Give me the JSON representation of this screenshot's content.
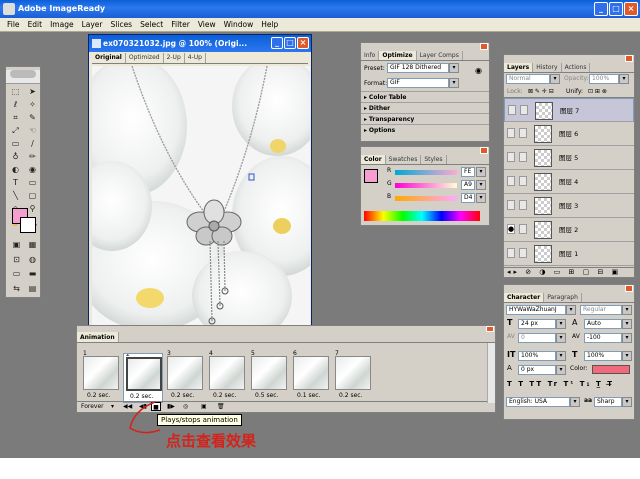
{
  "window": {
    "title": "Adobe ImageReady"
  },
  "menu": [
    "File",
    "Edit",
    "Image",
    "Layer",
    "Slices",
    "Select",
    "Filter",
    "View",
    "Window",
    "Help"
  ],
  "image_window": {
    "title": "ex070321032.jpg @ 100% (Origi...",
    "tabs": [
      "Original",
      "Optimized",
      "2-Up",
      "4-Up"
    ]
  },
  "optimize_panel": {
    "tabs": [
      "Info",
      "Optimize",
      "Layer Comps"
    ],
    "preset_label": "Preset:",
    "preset_value": "GIF 128 Dithered",
    "format_label": "Format:",
    "format_value": "GIF",
    "sections": [
      "Color Table",
      "Dither",
      "Transparency",
      "Options"
    ]
  },
  "color_panel": {
    "tabs": [
      "Color",
      "Swatches",
      "Styles"
    ],
    "channels": [
      {
        "label": "R",
        "value": "FE"
      },
      {
        "label": "G",
        "value": "A9"
      },
      {
        "label": "B",
        "value": "D4"
      }
    ],
    "foreground": "#f49fd0"
  },
  "layers_panel": {
    "tabs": [
      "Layers",
      "History",
      "Actions"
    ],
    "blend_mode": "Normal",
    "opacity_label": "Opacity:",
    "opacity_value": "100%",
    "lock_label": "Lock:",
    "unify_label": "Unify:",
    "layers": [
      "图层 7",
      "图层 6",
      "图层 5",
      "图层 4",
      "图层 3",
      "图层 2",
      "图层 1"
    ]
  },
  "character_panel": {
    "tabs": [
      "Character",
      "Paragraph"
    ],
    "font": "HYWaWaZhuanJ",
    "style": "Regular",
    "size": "24 px",
    "leading": "Auto",
    "kerning": "0",
    "tracking": "-100",
    "vscale": "100%",
    "hscale": "100%",
    "baseline": "0 px",
    "color_label": "Color:",
    "language": "English: USA",
    "aa_label": "aa",
    "antialias": "Sharp"
  },
  "animation_panel": {
    "title": "Animation",
    "frames": [
      {
        "num": "1",
        "delay": "0.2 sec."
      },
      {
        "num": "2",
        "delay": "0.2 sec."
      },
      {
        "num": "3",
        "delay": "0.2 sec."
      },
      {
        "num": "4",
        "delay": "0.2 sec."
      },
      {
        "num": "5",
        "delay": "0.5 sec."
      },
      {
        "num": "6",
        "delay": "0.1 sec."
      },
      {
        "num": "7",
        "delay": "0.2 sec."
      }
    ],
    "loop": "Forever"
  },
  "tooltip": "Plays/stops animation",
  "annotation": "点击查看效果"
}
